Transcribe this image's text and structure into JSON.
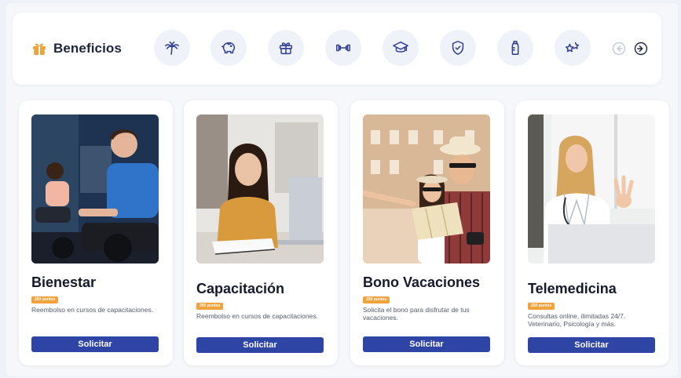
{
  "header": {
    "title": "Beneficios",
    "brand_icon": "gift-icon",
    "benefit_icons": [
      "palm-tree-icon",
      "piggy-bank-icon",
      "gift-icon",
      "dumbbell-icon",
      "graduation-cap-icon",
      "shield-check-icon",
      "baby-bottle-icon",
      "stars-icon"
    ],
    "nav_prev_icon": "arrow-left-circle-icon",
    "nav_next_icon": "arrow-right-circle-icon"
  },
  "colors": {
    "accent": "#2e45a5",
    "badge": "#f2a23a",
    "icon_stroke": "#2e3d8f",
    "brand_icon": "#f2a23a"
  },
  "cards": [
    {
      "title": "Bienestar",
      "badge": "250 puntos",
      "description": "Reembolso en cursos de capacitaciones.",
      "button": "Solicitar"
    },
    {
      "title": "Capacitación",
      "badge": "250 puntos",
      "description": "Reembolso en cursos de capacitaciones.",
      "button": "Solicitar"
    },
    {
      "title": "Bono Vacaciones",
      "badge": "250 puntos",
      "description": "Solicita el bono para disfrutar de tus vacaciones.",
      "button": "Solicitar"
    },
    {
      "title": "Telemedicina",
      "badge": "250 puntos",
      "description": "Consultas online, ilimitadas 24/7. Veterinario, Psicología y más.",
      "button": "Solicitar"
    }
  ]
}
